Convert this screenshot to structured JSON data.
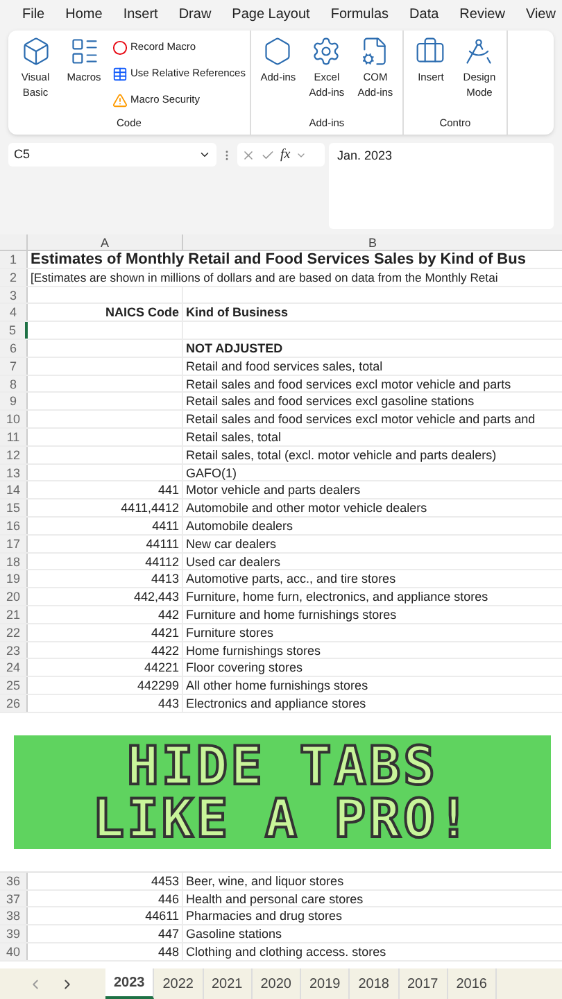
{
  "menu": [
    {
      "label": "File",
      "selected": false
    },
    {
      "label": "Home",
      "selected": false
    },
    {
      "label": "Insert",
      "selected": false
    },
    {
      "label": "Draw",
      "selected": false
    },
    {
      "label": "Page Layout",
      "selected": false
    },
    {
      "label": "Formulas",
      "selected": false
    },
    {
      "label": "Data",
      "selected": false
    },
    {
      "label": "Review",
      "selected": false
    },
    {
      "label": "View",
      "selected": false
    }
  ],
  "ribbon": {
    "groups": [
      {
        "label": "Code",
        "big": [
          {
            "kind": "vb",
            "label": "Visual Basic"
          },
          {
            "kind": "macros",
            "label": "Macros"
          }
        ],
        "small": [
          {
            "kind": "record",
            "label": "Record Macro"
          },
          {
            "kind": "relative",
            "label": "Use Relative References"
          },
          {
            "kind": "security",
            "label": "Macro Security"
          }
        ]
      },
      {
        "label": "Add-ins",
        "big": [
          {
            "kind": "addins",
            "label": "Add-ins"
          },
          {
            "kind": "excel-addins",
            "label": "Excel Add-ins"
          },
          {
            "kind": "com-addins",
            "label": "COM Add-ins"
          }
        ]
      },
      {
        "label": "Contro",
        "big": [
          {
            "kind": "insert",
            "label": "Insert"
          },
          {
            "kind": "design",
            "label": "Design Mode"
          }
        ]
      }
    ]
  },
  "formula_bar": {
    "name_box": "C5",
    "fx": "fx",
    "value": "Jan. 2023"
  },
  "columns": [
    "A",
    "B"
  ],
  "rows": [
    {
      "num": "1",
      "kind": "title",
      "a": "",
      "b": "Estimates of Monthly Retail and Food Services Sales by Kind of Bus"
    },
    {
      "num": "2",
      "kind": "plain",
      "a": "",
      "b": "[Estimates are shown in millions of dollars and are based on data from the Monthly Retai"
    },
    {
      "num": "3",
      "kind": "plain",
      "a": "",
      "b": ""
    },
    {
      "num": "4",
      "kind": "header",
      "a": "NAICS  Code",
      "b": "Kind of Business"
    },
    {
      "num": "5",
      "kind": "plain",
      "a": "",
      "b": ""
    },
    {
      "num": "6",
      "kind": "header",
      "a": "",
      "b": "NOT ADJUSTED"
    },
    {
      "num": "7",
      "kind": "plain",
      "a": "",
      "b": "Retail and food services sales, total"
    },
    {
      "num": "8",
      "kind": "plain",
      "a": "",
      "b": "Retail sales and food services excl motor vehicle and parts"
    },
    {
      "num": "9",
      "kind": "plain",
      "a": "",
      "b": "Retail sales and food services excl gasoline stations"
    },
    {
      "num": "10",
      "kind": "plain",
      "a": "",
      "b": "Retail sales and food services excl motor vehicle and parts and"
    },
    {
      "num": "11",
      "kind": "plain",
      "a": "",
      "b": "Retail sales, total"
    },
    {
      "num": "12",
      "kind": "plain",
      "a": "",
      "b": "Retail sales, total (excl. motor vehicle and parts dealers)"
    },
    {
      "num": "13",
      "kind": "plain",
      "a": "",
      "b": "GAFO(1)"
    },
    {
      "num": "14",
      "kind": "plain",
      "a": "441",
      "b": "Motor vehicle and parts dealers"
    },
    {
      "num": "15",
      "kind": "plain",
      "a": "4411,4412",
      "b": "Automobile and other motor vehicle dealers"
    },
    {
      "num": "16",
      "kind": "plain",
      "a": "4411",
      "b": "Automobile dealers"
    },
    {
      "num": "17",
      "kind": "plain",
      "a": "44111",
      "b": "New car dealers"
    },
    {
      "num": "18",
      "kind": "plain",
      "a": "44112",
      "b": "Used car dealers"
    },
    {
      "num": "19",
      "kind": "plain",
      "a": "4413",
      "b": "Automotive parts, acc., and tire stores"
    },
    {
      "num": "20",
      "kind": "plain",
      "a": "442,443",
      "b": "Furniture, home furn, electronics, and appliance stores"
    },
    {
      "num": "21",
      "kind": "plain",
      "a": "442",
      "b": "Furniture and home furnishings stores"
    },
    {
      "num": "22",
      "kind": "plain",
      "a": "4421",
      "b": "Furniture stores"
    },
    {
      "num": "23",
      "kind": "plain",
      "a": "4422",
      "b": "Home furnishings stores"
    },
    {
      "num": "24",
      "kind": "plain",
      "a": "44221",
      "b": "Floor covering stores"
    },
    {
      "num": "25",
      "kind": "plain",
      "a": "442299",
      "b": "All other home furnishings stores"
    },
    {
      "num": "26",
      "kind": "plain",
      "a": "443",
      "b": "Electronics and appliance stores"
    },
    {
      "kind": "banner",
      "lines": [
        "HIDE TABS",
        "LIKE A PRO!"
      ]
    },
    {
      "num": "36",
      "kind": "plain",
      "a": "4453",
      "b": "Beer, wine, and liquor stores"
    },
    {
      "num": "37",
      "kind": "plain",
      "a": "446",
      "b": "Health and personal care stores"
    },
    {
      "num": "38",
      "kind": "plain",
      "a": "44611",
      "b": "Pharmacies and drug stores"
    },
    {
      "num": "39",
      "kind": "plain",
      "a": "447",
      "b": "Gasoline stations"
    },
    {
      "num": "40",
      "kind": "plain",
      "a": "448",
      "b": "Clothing and clothing access. stores"
    }
  ],
  "sheet_tabs": [
    {
      "label": "2023",
      "selected": true
    },
    {
      "label": "2022",
      "selected": false
    },
    {
      "label": "2021",
      "selected": false
    },
    {
      "label": "2020",
      "selected": false
    },
    {
      "label": "2019",
      "selected": false
    },
    {
      "label": "2018",
      "selected": false
    },
    {
      "label": "2017",
      "selected": false
    },
    {
      "label": "2016",
      "selected": false
    }
  ]
}
